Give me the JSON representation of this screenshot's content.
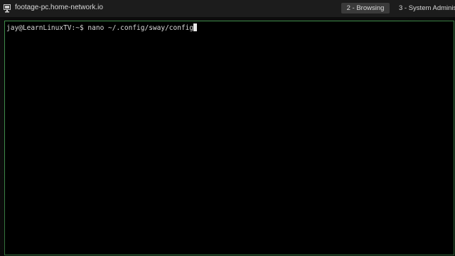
{
  "topbar": {
    "host_icon": "computer-monitor-icon",
    "hostname": "footage-pc.home-network.io",
    "workspaces": [
      {
        "label": "2 - Browsing",
        "active": true
      },
      {
        "label": "3 - System Administ",
        "active": false
      }
    ]
  },
  "terminal": {
    "prompt": "jay@LearnLinuxTV:~$",
    "command": "nano ~/.config/sway/config"
  },
  "colors": {
    "focused_border": "#3f8c4a",
    "bar_background": "#1c1c1c",
    "active_workspace": "#3a3a3a"
  }
}
